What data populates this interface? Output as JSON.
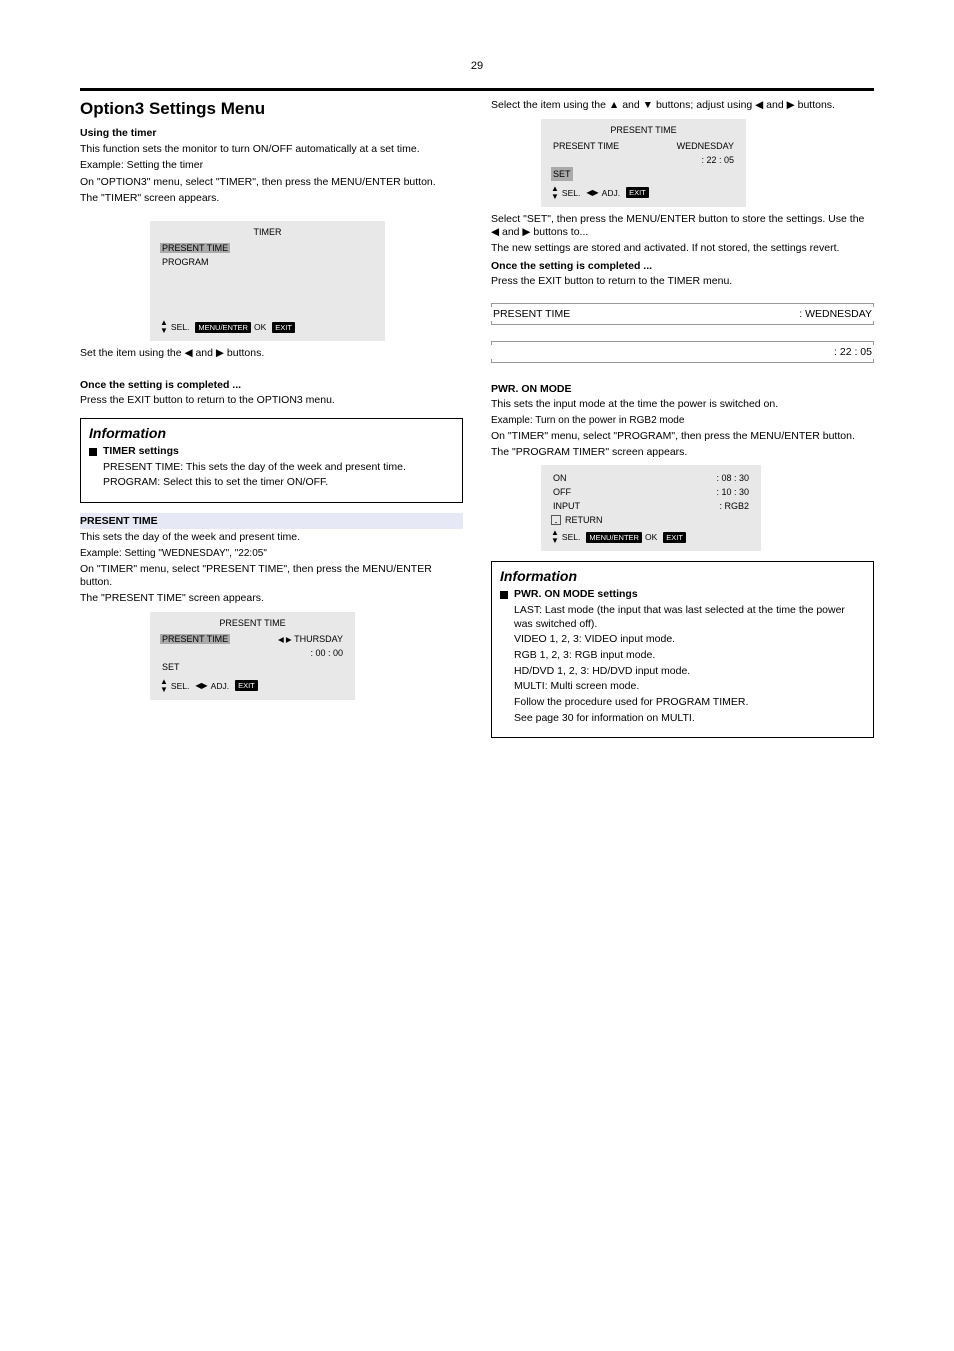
{
  "page_number": "29",
  "left": {
    "heading": "Option3 Settings Menu",
    "sub1_title": "Using the timer",
    "sub1_body": "This function sets the monitor to turn ON/OFF automatically at a set time.",
    "ex_line": "Example: Setting the timer",
    "step1": "On \"OPTION3\" menu, select \"TIMER\", then press the MENU/ENTER button.",
    "step2": "The \"TIMER\" screen appears.",
    "osd1": {
      "title": "TIMER",
      "row_selected": "PRESENT TIME",
      "row2": "PROGRAM",
      "hint_sel": "SEL.",
      "hint_ok": "OK",
      "hint_ok_btn": "MENU/ENTER",
      "hint_exit": "EXIT"
    },
    "step_set_time": "Set the item using the ◀ and ▶ buttons.",
    "after_step": "Once the setting is completed ...",
    "after_step2": "Press the EXIT button to return to the OPTION3 menu.",
    "info1_title": "Information",
    "info1_heading": "TIMER settings",
    "info1_line1": "PRESENT TIME: This sets the day of the week and present time.",
    "info1_line2": "PROGRAM: Select this to set the timer ON/OFF.",
    "blue_head": "PRESENT TIME",
    "blue_body1": "This sets the day of the week and present time.",
    "blue_ex": "Example: Setting \"WEDNESDAY\", \"22:05\"",
    "blue_step": "On \"TIMER\" menu, select \"PRESENT TIME\", then press the MENU/ENTER button.",
    "blue_step2": "The \"PRESENT TIME\" screen appears.",
    "osd2": {
      "title": "PRESENT TIME",
      "row_present": "PRESENT TIME",
      "val1": "THURSDAY",
      "val2": ":  00 : 00",
      "row_set": "SET",
      "arrows": "◀   ▶",
      "hint_sel": "SEL.",
      "hint_adj": "ADJ.",
      "hint_exit": "EXIT"
    }
  },
  "right": {
    "step3": "Select the item using the ▲ and ▼ buttons; adjust using ◀ and ▶ buttons.",
    "osd3": {
      "title": "PRESENT TIME",
      "row_present": "PRESENT TIME",
      "val1": "WEDNESDAY",
      "val2": ":  22 : 05",
      "row_set": "SET",
      "hint_sel": "SEL.",
      "hint_adj": "ADJ.",
      "hint_exit": "EXIT"
    },
    "set_note": "Select \"SET\", then press the MENU/ENTER button to store the settings. Use the ◀ and ▶ buttons to...",
    "set_note2": "The new settings are stored and activated. If not stored, the settings revert.",
    "after_step": "Once the setting is completed ...",
    "after_step2": "Press the EXIT button to return to the TIMER menu.",
    "setting1_l": "PRESENT TIME",
    "setting1_r": ": WEDNESDAY",
    "setting2_l": "",
    "setting2_r": ": 22 : 05",
    "pwm_head": "PWR. ON MODE",
    "pwm_body": "This sets the input mode at the time the power is switched on.",
    "pwm_ex": "Example: Turn on the power in RGB2 mode",
    "pwm_step": "On \"TIMER\" menu, select \"PROGRAM\", then press the MENU/ENTER button.",
    "pwm_step2": "The \"PROGRAM TIMER\" screen appears.",
    "osd4": {
      "title": "",
      "row_on": "ON",
      "row_off": "OFF",
      "row_input": "INPUT",
      "val_on": ": 08 : 30",
      "val_off": ": 10 : 30",
      "val_input": ": RGB2",
      "return": "RETURN",
      "hint_sel": "SEL.",
      "hint_ok": "OK",
      "hint_ok_btn": "MENU/ENTER",
      "hint_exit": "EXIT"
    },
    "info2_title": "Information",
    "info2_heading": "PWR. ON MODE settings",
    "info2_line1": "LAST: Last mode (the input that was last selected at the time the power was switched off).",
    "info2_line2": "VIDEO 1, 2, 3: VIDEO input mode.",
    "info2_line3": "RGB 1, 2, 3: RGB input mode.",
    "info2_line4": "HD/DVD 1, 2, 3: HD/DVD input mode.",
    "info2_line5": "MULTI: Multi screen mode.",
    "info2_line6": "Follow the procedure used for PROGRAM TIMER.",
    "info2_line7": "See page 30 for information on MULTI."
  }
}
